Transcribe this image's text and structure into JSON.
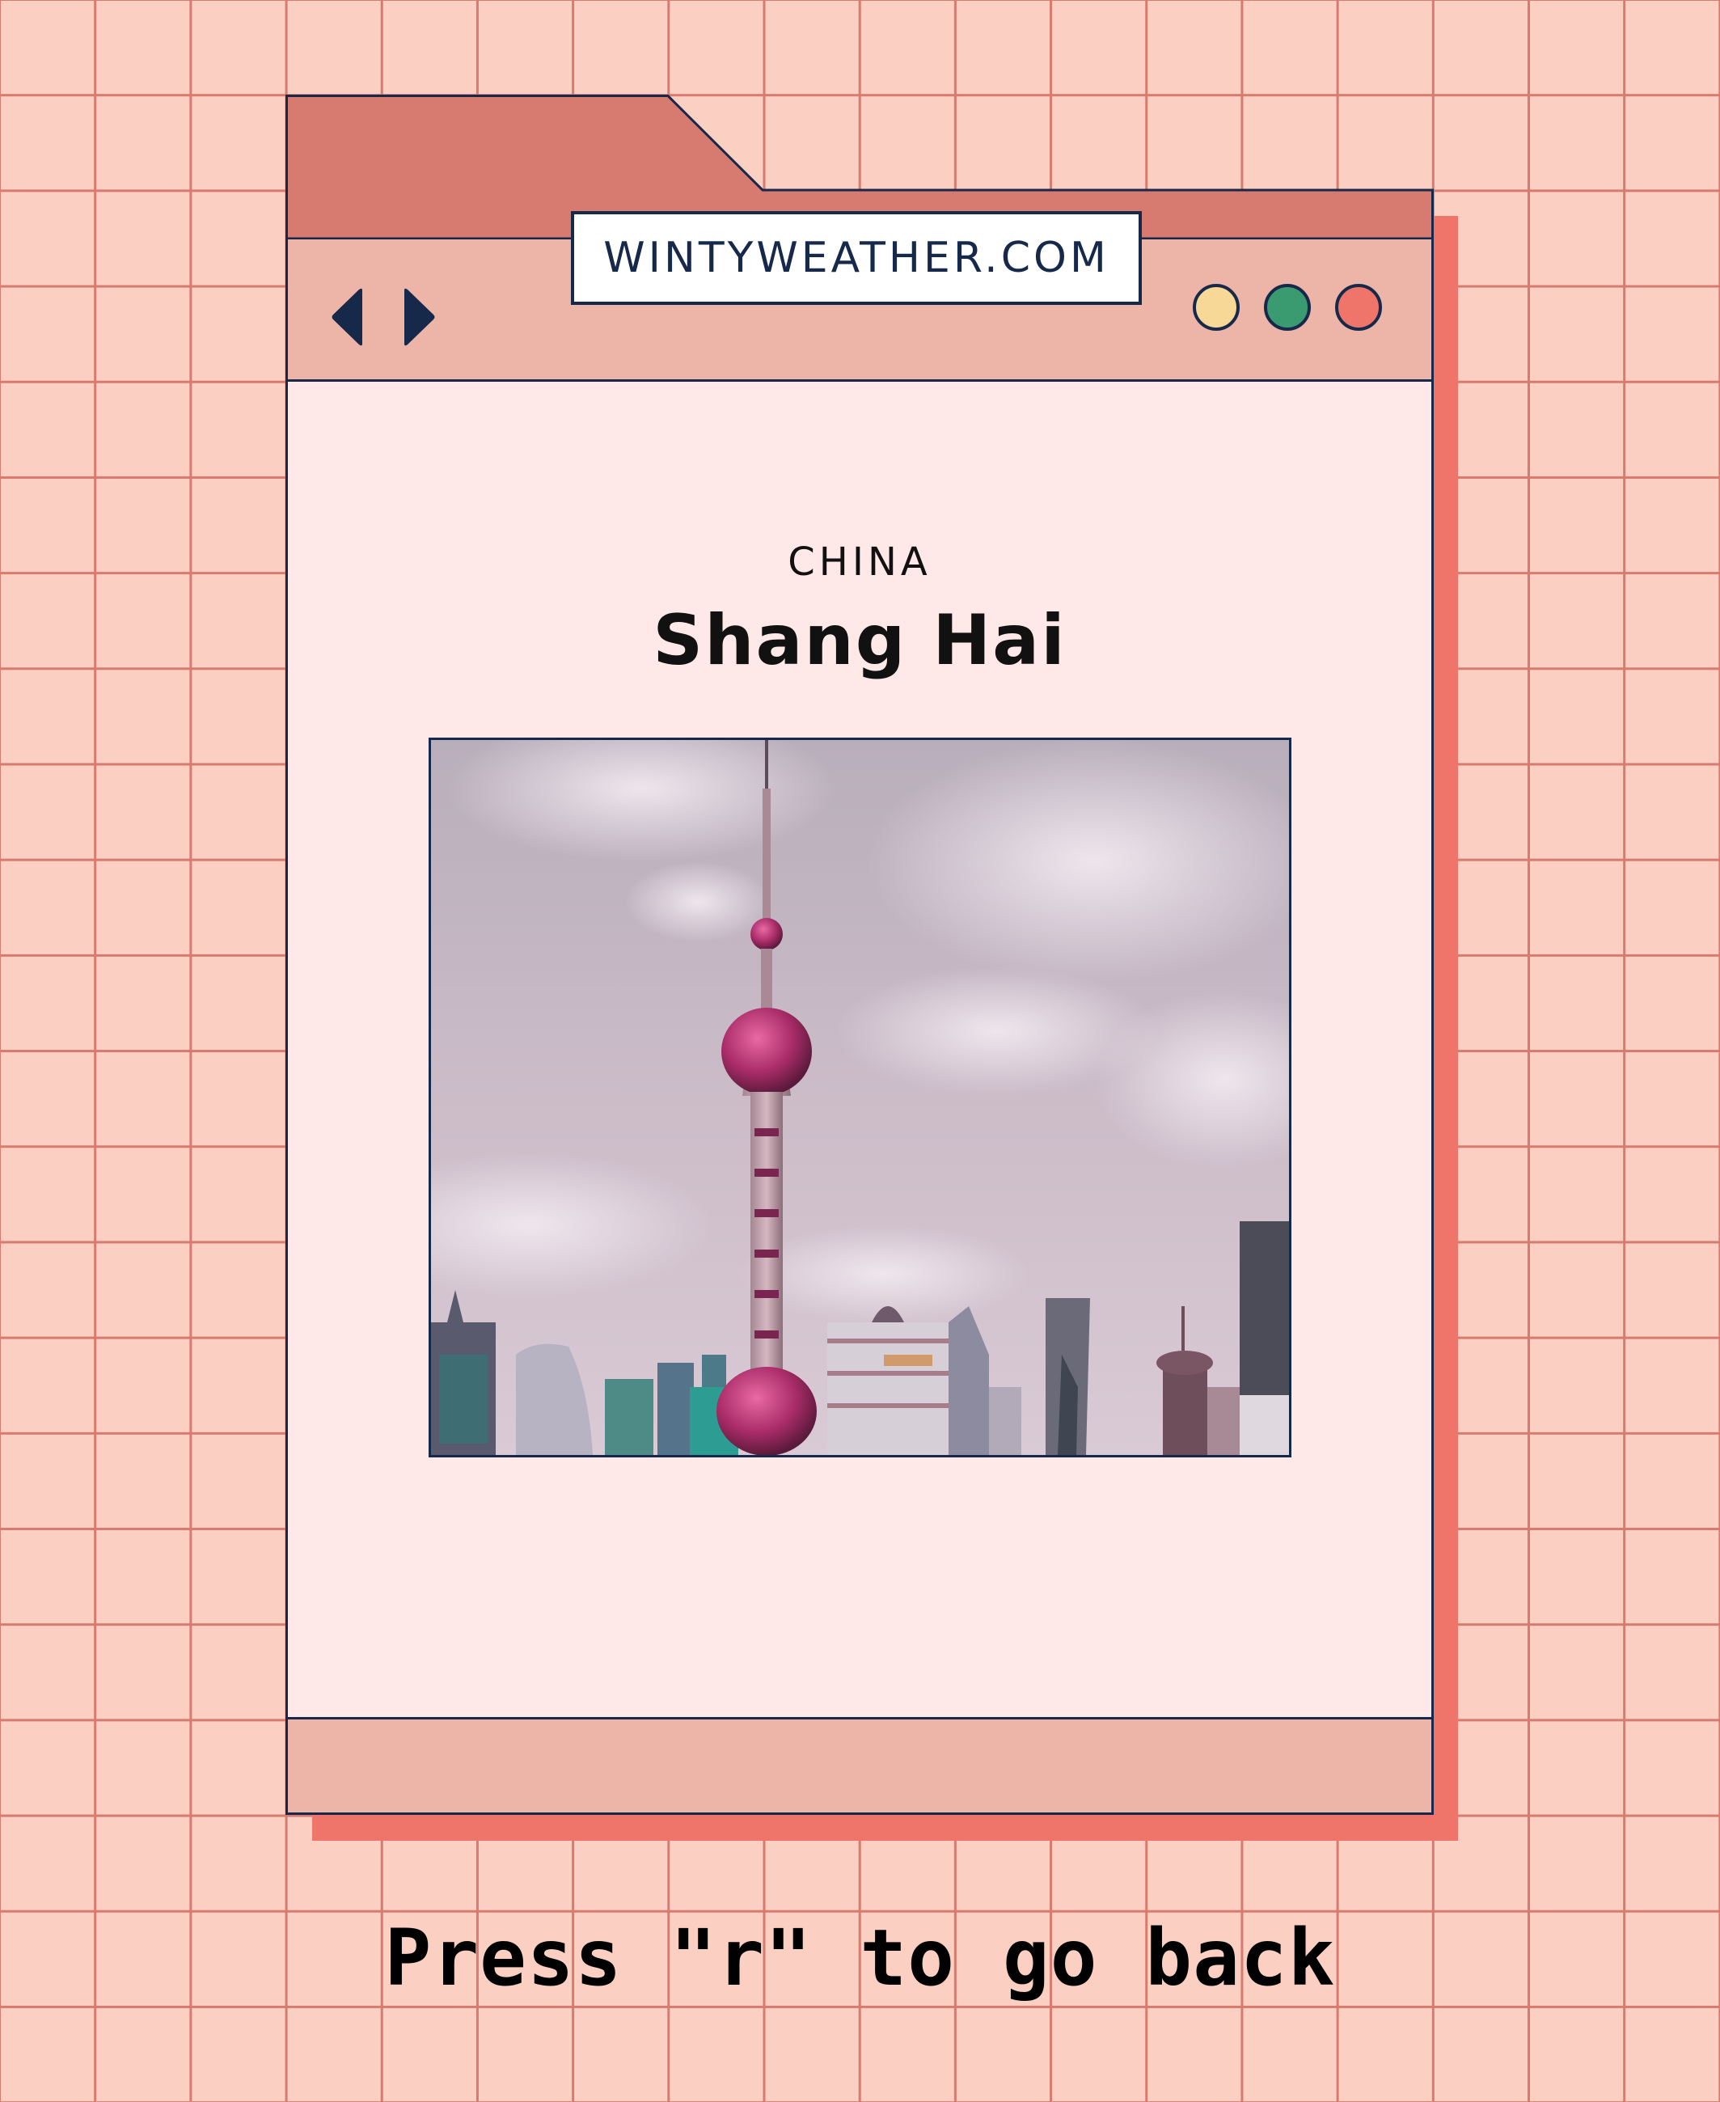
{
  "browser": {
    "url": "WINTYWEATHER.COM",
    "nav": {
      "back_icon": "triangle-left-icon",
      "forward_icon": "triangle-right-icon"
    },
    "window_controls": [
      {
        "name": "yellow",
        "color": "#f7d896"
      },
      {
        "name": "green",
        "color": "#3a9a70"
      },
      {
        "name": "red",
        "color": "#ef746a"
      }
    ]
  },
  "location": {
    "country": "CHINA",
    "city": "Shang Hai"
  },
  "footer_hint": "Press \"r\" to go back",
  "colors": {
    "background": "#fbd0c3",
    "grid_line": "#d77a6f",
    "tab": "#d77a6f",
    "toolbar": "#edb5a8",
    "content": "#fee9e8",
    "shadow": "#ef756b",
    "outline": "#17294a"
  }
}
